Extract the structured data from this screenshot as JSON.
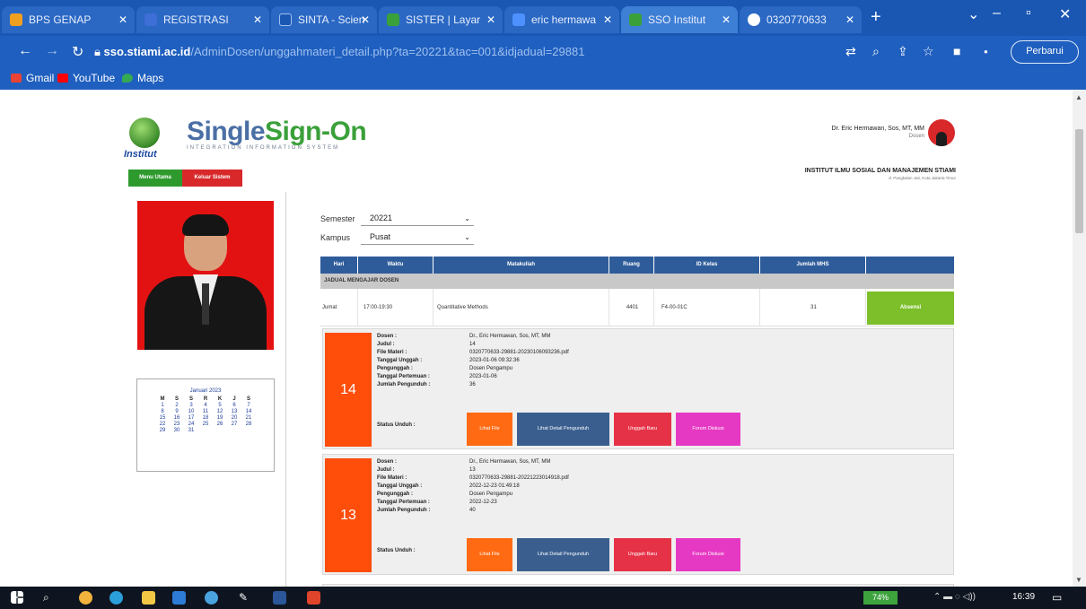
{
  "browser": {
    "tabs": [
      {
        "label": "BPS GENAP",
        "favicon_color": "#f0a020"
      },
      {
        "label": "REGISTRASI",
        "favicon_color": "#3e6fd6"
      },
      {
        "label": "SINTA - Scien",
        "favicon_color": "#1a57b3"
      },
      {
        "label": "SISTER | Layar",
        "favicon_color": "#3aa03a"
      },
      {
        "label": "eric hermawa",
        "favicon_color": "#4d90fe"
      },
      {
        "label": "SSO Institut",
        "favicon_color": "#3aa03a"
      },
      {
        "label": "0320770633",
        "favicon_color": "#ffffff"
      }
    ],
    "url_domain": "sso.stiami.ac.id",
    "url_path": "/AdminDosen/unggahmateri_detail.php?ta=20221&tac=001&idjadual=29881",
    "profile_label": "Perbarui",
    "bookmarks": [
      {
        "label": "Gmail",
        "color": "#ea4335"
      },
      {
        "label": "YouTube",
        "color": "#ff0000"
      },
      {
        "label": "Maps",
        "color": "#34a853"
      }
    ]
  },
  "header": {
    "brand_part1": "Single",
    "brand_part2": "Sign-On",
    "brand_sub": "INTEGRATION INFORMATION SYSTEM",
    "logo_caption": "Institut",
    "user_name": "Dr. Eric Hermawan, Sos, MT, MM",
    "user_role": "Dosen",
    "institution": "INSTITUT ILMU SOSIAL DAN MANAJEMEN STIAMI",
    "institution_address": "Jl. Pangkalan Jati, Kota Jakarta Timur"
  },
  "nav": {
    "menu_utama": "Menu Utama",
    "keluar": "Keluar Sistem"
  },
  "calendar": {
    "title": "Januari 2023",
    "headers": [
      "M",
      "S",
      "S",
      "R",
      "K",
      "J",
      "S"
    ],
    "days": [
      "1",
      "2",
      "3",
      "4",
      "5",
      "6",
      "7",
      "8",
      "9",
      "10",
      "11",
      "12",
      "13",
      "14",
      "15",
      "16",
      "17",
      "18",
      "19",
      "20",
      "21",
      "22",
      "23",
      "24",
      "25",
      "26",
      "27",
      "28",
      "29",
      "30",
      "31"
    ]
  },
  "filters": {
    "semester_label": "Semester",
    "semester_value": "20221",
    "kampus_label": "Kampus",
    "kampus_value": "Pusat"
  },
  "table": {
    "headers": [
      "Hari",
      "Waktu",
      "Matakuliah",
      "Ruang",
      "ID Kelas",
      "Jumlah MHS",
      ""
    ],
    "section_title": "JADUAL MENGAJAR DOSEN",
    "row": {
      "hari": "Jumat",
      "waktu": "17:00-19:30",
      "matakuliah": "Quantitative Methods",
      "ruang": "4401",
      "id_kelas": "F4-00-01C",
      "jumlah": "31",
      "action": "Absensi"
    }
  },
  "card_labels": [
    "Dosen :",
    "Judul :",
    "File Materi :",
    "Tanggal Unggah :",
    "Pengunggah :",
    "Tanggal Pertemuan :",
    "Jumlah Pengunduh :"
  ],
  "status_label": "Status Unduh :",
  "buttons": {
    "lihat_file": "Lihat File",
    "lihat_detail": "Lihat Detail Pengunduh",
    "unggah_baru": "Unggah Baru",
    "forum": "Forum Diskusi"
  },
  "materials": [
    {
      "number": "14",
      "dosen": "Dr., Eric Hermawan, Sos, MT, MM",
      "judul": "14",
      "file": "0320770633-29881-20230106093236.pdf",
      "tanggal_unggah": "2023-01-06 09:32:36",
      "pengunggah": "Dosen Pengampu",
      "tanggal_pertemuan": "2023-01-06",
      "jumlah_pengunduh": "36"
    },
    {
      "number": "13",
      "dosen": "Dr., Eric Hermawan, Sos, MT, MM",
      "judul": "13",
      "file": "0320770633-29881-20221223014918.pdf",
      "tanggal_unggah": "2022-12-23 01:49:18",
      "pengunggah": "Dosen Pengampu",
      "tanggal_pertemuan": "2022-12-23",
      "jumlah_pengunduh": "40"
    }
  ],
  "taskbar": {
    "battery": "74%",
    "time": "16:39"
  }
}
